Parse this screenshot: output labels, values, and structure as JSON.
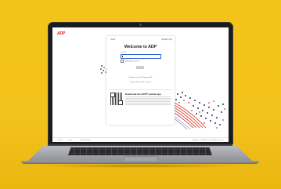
{
  "screen": {
    "logo": "ADP",
    "back": "← Back",
    "language": "English (US)",
    "welcome": "Welcome to ADP",
    "user_id_label": "User ID",
    "remember_label": "Remember user ID",
    "next_label": "Next",
    "forgot": "Forgot your user ID/password?",
    "new_user_prefix": "New user?",
    "new_user_link": "Create account",
    "app_title": "Download the ADP® mobile app",
    "footer_links": [
      "Privacy",
      "Legal",
      "Requirements"
    ],
    "footer_copy": "Copyright © 2022 ADP, Inc. All rights reserved."
  },
  "colors": {
    "background": "#f2c318",
    "adp_red": "#d0271d",
    "link_blue": "#2c63c9",
    "dot_navy": "#2a2f6e",
    "dot_red": "#d33a2c"
  }
}
